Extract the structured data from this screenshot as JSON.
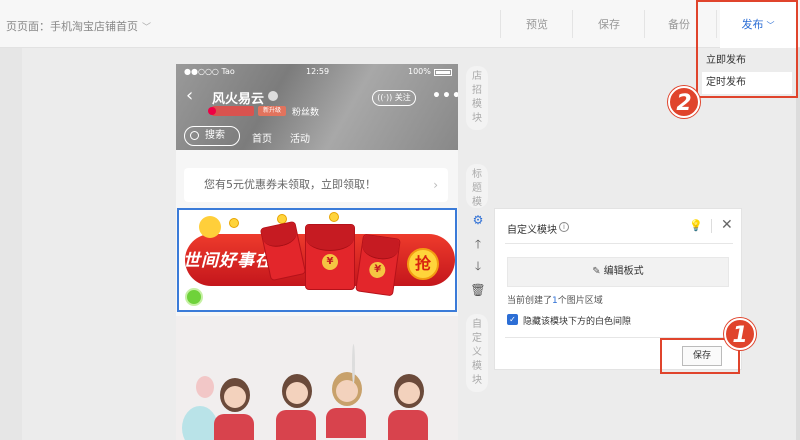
{
  "topbar": {
    "page_label": "页页面：手机淘宝店铺首页",
    "preview": "预览",
    "save": "保存",
    "backup": "备份",
    "publish": "发布"
  },
  "publish_menu": {
    "items": [
      "立即发布",
      "定时发布"
    ]
  },
  "badges": [
    "1",
    "2"
  ],
  "phone": {
    "status": {
      "carrier": "●●○○○ Tao",
      "time": "12:59",
      "battery": "100%"
    },
    "shop_name": "风火易云",
    "tag2": "新升级",
    "fans": "粉丝数",
    "follow": "关注",
    "search": "搜索",
    "nav": [
      "首页",
      "活动"
    ],
    "coupon": "您有5元优惠券未领取，立即领取！",
    "banner_text": "世间好事在此",
    "qiang": "抢",
    "yen": "¥"
  },
  "side_labels": {
    "shop_sign": [
      "店",
      "招",
      "模",
      "块"
    ],
    "title": [
      "标",
      "题",
      "模"
    ],
    "custom": [
      "自",
      "定",
      "义",
      "模",
      "块"
    ]
  },
  "panel": {
    "title": "自定义模块",
    "edit_button": "编辑板式",
    "created_prefix": "当前创建了",
    "created_num": "1",
    "created_suffix": "个图片区域",
    "checkbox_label": "隐藏该模块下方的白色间隙",
    "save": "保存"
  },
  "icons": [
    "chevron-down-icon",
    "back-icon",
    "verified-icon",
    "more-icon",
    "search-icon",
    "gear-icon",
    "arrow-up-icon",
    "arrow-down-icon",
    "trash-icon",
    "info-icon",
    "bulb-icon",
    "close-icon",
    "pen-icon",
    "checkbox-icon"
  ],
  "colors": {
    "accent": "#2c6ed5",
    "highlight": "#e0442c",
    "banner_red": "#e3262b"
  }
}
